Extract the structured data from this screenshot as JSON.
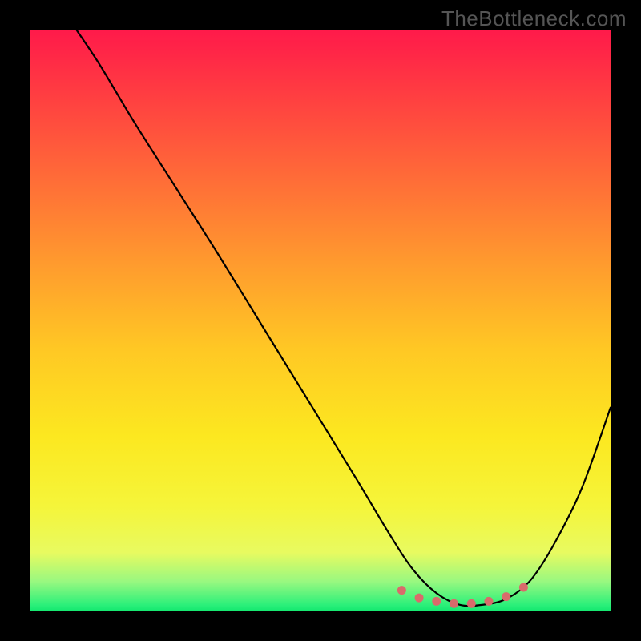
{
  "watermark": "TheBottleneck.com",
  "chart_data": {
    "type": "line",
    "title": "",
    "xlabel": "",
    "ylabel": "",
    "xlim": [
      0,
      100
    ],
    "ylim": [
      0,
      100
    ],
    "series": [
      {
        "name": "curve",
        "x": [
          8,
          12,
          18,
          25,
          32,
          40,
          48,
          56,
          62,
          66,
          70,
          74,
          78,
          82,
          86,
          90,
          95,
          100
        ],
        "y": [
          100,
          94,
          84,
          73,
          62,
          49,
          36,
          23,
          13,
          7,
          3,
          1,
          1,
          2,
          5,
          11,
          21,
          35
        ]
      }
    ],
    "markers": {
      "name": "flat-region-dots",
      "color": "#d96b6b",
      "points": [
        {
          "x": 64,
          "y": 3.5
        },
        {
          "x": 67,
          "y": 2.2
        },
        {
          "x": 70,
          "y": 1.6
        },
        {
          "x": 73,
          "y": 1.2
        },
        {
          "x": 76,
          "y": 1.2
        },
        {
          "x": 79,
          "y": 1.6
        },
        {
          "x": 82,
          "y": 2.4
        },
        {
          "x": 85,
          "y": 4.0
        }
      ]
    },
    "gradient_stops": [
      {
        "offset": 0,
        "color": "#ff1a4a"
      },
      {
        "offset": 25,
        "color": "#ff6a38"
      },
      {
        "offset": 55,
        "color": "#ffc824"
      },
      {
        "offset": 82,
        "color": "#f5f53a"
      },
      {
        "offset": 100,
        "color": "#15e870"
      }
    ]
  }
}
